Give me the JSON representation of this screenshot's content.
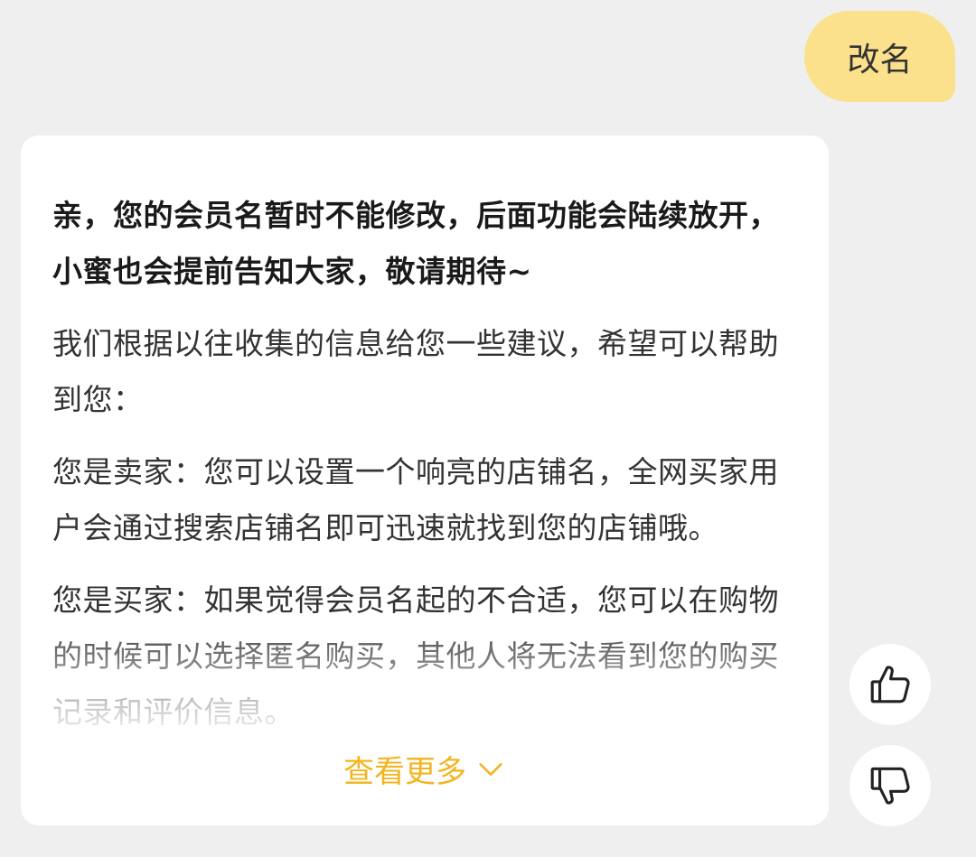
{
  "user_message": {
    "text": "改名"
  },
  "reply": {
    "paragraphs": [
      "亲，您的会员名暂时不能修改，后面功能会陆续放开，小蜜也会提前告知大家，敬请期待~",
      "我们根据以往收集的信息给您一些建议，希望可以帮助到您：",
      "您是卖家：您可以设置一个响亮的店铺名，全网买家用户会通过搜索店铺名即可迅速就找到您的店铺哦。",
      "您是买家：如果觉得会员名起的不合适，您可以在购物的时候可以选择匿名购买，其他人将无法看到您的购买记录和评价信息。"
    ],
    "expand_label": "查看更多",
    "expand_icon": "chevron-down-icon"
  },
  "feedback": {
    "like_icon": "thumbs-up-icon",
    "dislike_icon": "thumbs-down-icon"
  },
  "colors": {
    "user_bubble": "#fbe18b",
    "accent": "#f2b51f",
    "background": "#efefef",
    "card": "#ffffff"
  }
}
